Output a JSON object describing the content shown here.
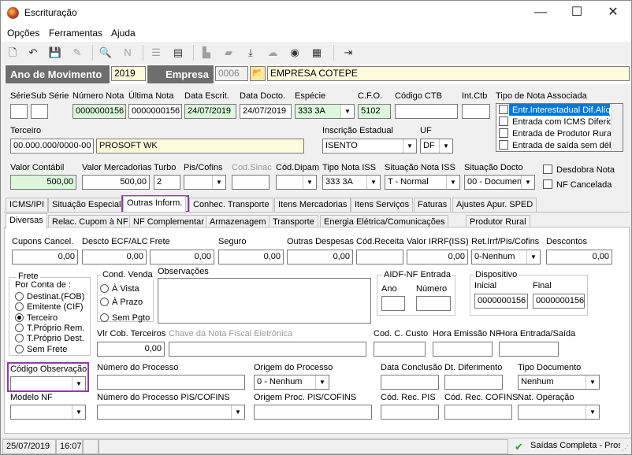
{
  "window": {
    "title": "Escrituração",
    "controls": [
      "—",
      "☐",
      "✕"
    ]
  },
  "menu": [
    "Opções",
    "Ferramentas",
    "Ajuda"
  ],
  "header": {
    "ano_label": "Ano de Movimento",
    "ano_value": "2019",
    "empresa_label": "Empresa",
    "empresa_code": "0006",
    "empresa_name": "EMPRESA COTEPE"
  },
  "row1": {
    "serie_label": "Série",
    "sub_serie_label": "Sub Série",
    "numero_nota_label": "Número Nota",
    "numero_nota": "0000000156",
    "ultima_nota_label": "Última Nota",
    "ultima_nota": "0000000156",
    "data_escrit_label": "Data Escrit.",
    "data_escrit": "24/07/2019",
    "data_docto_label": "Data Docto.",
    "data_docto": "24/07/2019",
    "especie_label": "Espécie",
    "especie": "333  3A",
    "cfo_label": "C.F.O.",
    "cfo": "5102",
    "codigo_ctb_label": "Código CTB",
    "int_ctb_label": "Int.Ctb"
  },
  "tipo_nota": {
    "label": "Tipo de Nota Associada",
    "items": [
      "Entr.Interestadual Dif.Alíq",
      "Entrada com ICMS Diferido",
      "Entrada de Produtor Rural",
      "Entrada de saída sem débi"
    ]
  },
  "row2": {
    "terceiro_label": "Terceiro",
    "terceiro_code": "00.000.000/0000-00",
    "terceiro_name": "PROSOFT WK",
    "ie_label": "Inscrição Estadual",
    "ie": "ISENTO",
    "uf_label": "UF",
    "uf": "DF"
  },
  "row3": {
    "valor_contabil_label": "Valor Contábil",
    "valor_contabil": "500,00",
    "valor_merc_label": "Valor Mercadorias",
    "valor_merc": "500,00",
    "turbo_label": "Turbo",
    "turbo": "2",
    "pis_label": "Pis/Cofins",
    "cod_sinac_label": "Cod.Sinac",
    "cod_dipam_label": "Cód.Dipam",
    "tipo_iss_label": "Tipo Nota ISS",
    "tipo_iss": "333  3A",
    "sit_iss_label": "Situação Nota ISS",
    "sit_iss": "T - Normal",
    "sit_docto_label": "Situação Docto",
    "sit_docto": "00 - Documen",
    "desdobra": "Desdobra Nota",
    "nf_cancelada": "NF Cancelada"
  },
  "tabs1": [
    "ICMS/IPI",
    "Situação Especial",
    "Outras Inform.",
    "Conhec. Transporte",
    "Itens Mercadorias",
    "Itens Serviços",
    "Faturas",
    "Ajustes Apur. SPED"
  ],
  "tabs2": [
    "Diversas",
    "Relac. Cupom à NF",
    "NF Complementar",
    "Armazenagem",
    "Transporte",
    "Energia Elétrica/Comunicações",
    "Produtor Rural"
  ],
  "diversas": {
    "cupons_label": "Cupons Cancel.",
    "cupons": "0,00",
    "descto_label": "Descto ECF/ALC",
    "descto": "0,00",
    "frete_label": "Frete",
    "frete": "0,00",
    "seguro_label": "Seguro",
    "seguro": "0,00",
    "outras_label": "Outras Despesas",
    "outras": "0,00",
    "cod_receita_label": "Cód.Receita",
    "valor_irrf_label": "Valor IRRF(ISS)",
    "valor_irrf": "0,00",
    "ret_irrf_label": "Ret.Irrf/Pis/Cofins",
    "ret_irrf": "0-Nenhum",
    "descontos_label": "Descontos",
    "descontos": "0,00",
    "frete_group": "Frete",
    "por_conta": "Por Conta de :",
    "frete_opts": [
      "Destinat.(FOB)",
      "Emitente (CIF)",
      "Terceiro",
      "T.Próprio Rem.",
      "T.Próprio Dest.",
      "Sem Frete"
    ],
    "cond_venda": "Cond. Venda",
    "cond_opts": [
      "À Vista",
      "À Prazo",
      "Sem Pgto"
    ],
    "observacoes_label": "Observações",
    "aidf_label": "AIDF-NF Entrada",
    "ano_label": "Ano",
    "numero_label": "Número",
    "dispositivo_label": "Dispositivo",
    "inicial_label": "Inicial",
    "inicial": "0000000156",
    "final_label": "Final",
    "final": "0000000156",
    "vlr_cob_label": "Vlr Cob. Terceiros",
    "vlr_cob": "0,00",
    "chave_label": "Chave da Nota Fiscal Eletrônica",
    "cod_custo_label": "Cod. C. Custo",
    "hora_emissao_label": "Hora Emissão NF",
    "hora_entrada_label": "Hora Entrada/Saída",
    "cod_obs_label": "Código Observação",
    "num_processo_label": "Número do Processo",
    "origem_label": "Origem do Processo",
    "origem": "0 - Nenhum",
    "data_conclusao_label": "Data Conclusão",
    "dt_diferimento_label": "Dt. Diferimento",
    "tipo_doc_label": "Tipo Documento",
    "tipo_doc": "Nenhum",
    "modelo_label": "Modelo NF",
    "num_proc_pis_label": "Número do Processo PIS/COFINS",
    "origem_pis_label": "Origem Proc. PIS/COFINS",
    "cod_rec_pis_label": "Cód. Rec. PIS",
    "cod_rec_cofins_label": "Cód. Rec. COFINS",
    "nat_op_label": "Nat. Operação"
  },
  "status": {
    "date": "25/07/2019",
    "time": "16:07",
    "message": "Saídas Completa - Pros"
  }
}
